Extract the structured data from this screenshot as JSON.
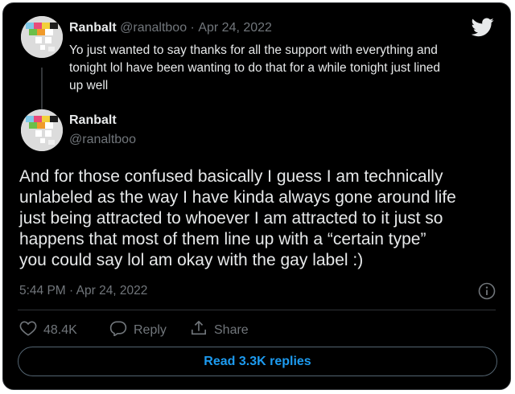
{
  "reply_tweet": {
    "author_name": "Ranbalt",
    "handle": "@ranaltboo",
    "separator": "·",
    "date": "Apr 24, 2022",
    "text_lines": [
      "Yo just wanted to say thanks for all the support with everything and",
      "tonight lol have been wanting to do that for a while tonight just lined",
      "up well"
    ]
  },
  "main_tweet": {
    "author_name": "Ranbalt",
    "handle": "@ranaltboo",
    "text_lines": [
      "And for those confused basically I guess I am technically",
      "unlabeled as the way I have kinda always gone around life",
      "just being attracted to whoever I am attracted to it just so",
      "happens that most of them line up with a “certain type”",
      "you could say lol am okay with the gay label :)"
    ],
    "timestamp": "5:44 PM · Apr 24, 2022"
  },
  "actions": {
    "like_count": "48.4K",
    "reply_label": "Reply",
    "share_label": "Share"
  },
  "read_replies_label": "Read 3.3K replies",
  "colors": {
    "background": "#000000",
    "text": "#e7e9ea",
    "muted": "#71767b",
    "accent": "#1d9bf0",
    "border": "#2f3336"
  },
  "icons": [
    "twitter-bird-icon",
    "info-icon",
    "heart-icon",
    "reply-icon",
    "share-icon"
  ]
}
